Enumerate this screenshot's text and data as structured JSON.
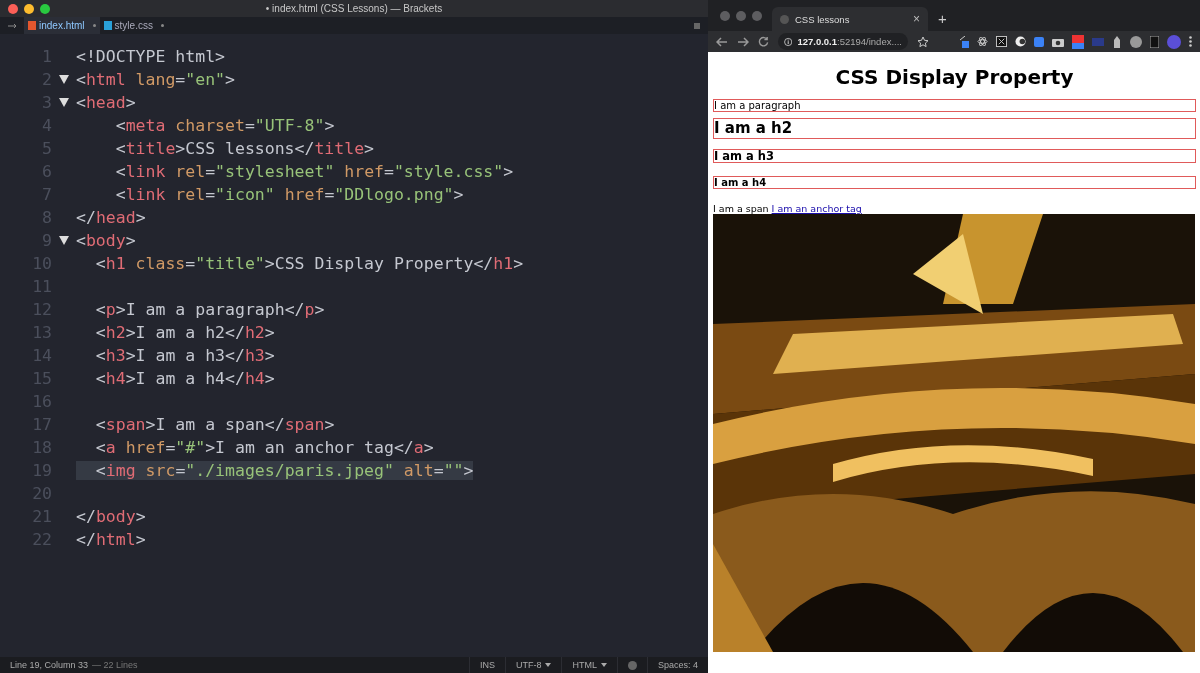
{
  "editor": {
    "window": {
      "title": "• index.html (CSS Lessons) — Brackets"
    },
    "tabs": [
      {
        "label": "index.html",
        "selected": true,
        "kind": "html",
        "modified": true
      },
      {
        "label": "style.css",
        "selected": false,
        "kind": "css",
        "modified": true
      }
    ],
    "lines": [
      {
        "number": "1",
        "fold": false,
        "selected": false,
        "tokens": [
          {
            "kind": "p",
            "text": "<!DOCTYPE html>"
          }
        ]
      },
      {
        "number": "2",
        "fold": true,
        "selected": false,
        "tokens": [
          {
            "kind": "p",
            "text": "<"
          },
          {
            "kind": "t",
            "text": "html"
          },
          {
            "kind": "a",
            "text": " lang"
          },
          {
            "kind": "p",
            "text": "="
          },
          {
            "kind": "s",
            "text": "\"en\""
          },
          {
            "kind": "p",
            "text": ">"
          }
        ]
      },
      {
        "number": "3",
        "fold": true,
        "selected": false,
        "tokens": [
          {
            "kind": "p",
            "text": "<"
          },
          {
            "kind": "t",
            "text": "head"
          },
          {
            "kind": "p",
            "text": ">"
          }
        ]
      },
      {
        "number": "4",
        "fold": false,
        "selected": false,
        "tokens": [
          {
            "kind": "p",
            "text": "    <"
          },
          {
            "kind": "t",
            "text": "meta"
          },
          {
            "kind": "a",
            "text": " charset"
          },
          {
            "kind": "p",
            "text": "="
          },
          {
            "kind": "s",
            "text": "\"UTF-8\""
          },
          {
            "kind": "p",
            "text": ">"
          }
        ]
      },
      {
        "number": "5",
        "fold": false,
        "selected": false,
        "tokens": [
          {
            "kind": "p",
            "text": "    <"
          },
          {
            "kind": "t",
            "text": "title"
          },
          {
            "kind": "p",
            "text": ">CSS lessons</"
          },
          {
            "kind": "t",
            "text": "title"
          },
          {
            "kind": "p",
            "text": ">"
          }
        ]
      },
      {
        "number": "6",
        "fold": false,
        "selected": false,
        "tokens": [
          {
            "kind": "p",
            "text": "    <"
          },
          {
            "kind": "t",
            "text": "link"
          },
          {
            "kind": "a",
            "text": " rel"
          },
          {
            "kind": "p",
            "text": "="
          },
          {
            "kind": "s",
            "text": "\"stylesheet\""
          },
          {
            "kind": "a",
            "text": " href"
          },
          {
            "kind": "p",
            "text": "="
          },
          {
            "kind": "s",
            "text": "\"style.css\""
          },
          {
            "kind": "p",
            "text": ">"
          }
        ]
      },
      {
        "number": "7",
        "fold": false,
        "selected": false,
        "tokens": [
          {
            "kind": "p",
            "text": "    <"
          },
          {
            "kind": "t",
            "text": "link"
          },
          {
            "kind": "a",
            "text": " rel"
          },
          {
            "kind": "p",
            "text": "="
          },
          {
            "kind": "s",
            "text": "\"icon\""
          },
          {
            "kind": "a",
            "text": " href"
          },
          {
            "kind": "p",
            "text": "="
          },
          {
            "kind": "s",
            "text": "\"DDlogo.png\""
          },
          {
            "kind": "p",
            "text": ">"
          }
        ]
      },
      {
        "number": "8",
        "fold": false,
        "selected": false,
        "tokens": [
          {
            "kind": "p",
            "text": "</"
          },
          {
            "kind": "t",
            "text": "head"
          },
          {
            "kind": "p",
            "text": ">"
          }
        ]
      },
      {
        "number": "9",
        "fold": true,
        "selected": false,
        "tokens": [
          {
            "kind": "p",
            "text": "<"
          },
          {
            "kind": "t",
            "text": "body"
          },
          {
            "kind": "p",
            "text": ">"
          }
        ]
      },
      {
        "number": "10",
        "fold": false,
        "selected": false,
        "tokens": [
          {
            "kind": "p",
            "text": "  <"
          },
          {
            "kind": "t",
            "text": "h1"
          },
          {
            "kind": "a",
            "text": " class"
          },
          {
            "kind": "p",
            "text": "="
          },
          {
            "kind": "s",
            "text": "\"title\""
          },
          {
            "kind": "p",
            "text": ">CSS Display Property</"
          },
          {
            "kind": "t",
            "text": "h1"
          },
          {
            "kind": "p",
            "text": ">"
          }
        ]
      },
      {
        "number": "11",
        "fold": false,
        "selected": false
      },
      {
        "number": "12",
        "fold": false,
        "selected": false,
        "tokens": [
          {
            "kind": "p",
            "text": "  <"
          },
          {
            "kind": "t",
            "text": "p"
          },
          {
            "kind": "p",
            "text": ">I am a paragraph</"
          },
          {
            "kind": "t",
            "text": "p"
          },
          {
            "kind": "p",
            "text": ">"
          }
        ]
      },
      {
        "number": "13",
        "fold": false,
        "selected": false,
        "tokens": [
          {
            "kind": "p",
            "text": "  <"
          },
          {
            "kind": "t",
            "text": "h2"
          },
          {
            "kind": "p",
            "text": ">I am a h2</"
          },
          {
            "kind": "t",
            "text": "h2"
          },
          {
            "kind": "p",
            "text": ">"
          }
        ]
      },
      {
        "number": "14",
        "fold": false,
        "selected": false,
        "tokens": [
          {
            "kind": "p",
            "text": "  <"
          },
          {
            "kind": "t",
            "text": "h3"
          },
          {
            "kind": "p",
            "text": ">I am a h3</"
          },
          {
            "kind": "t",
            "text": "h3"
          },
          {
            "kind": "p",
            "text": ">"
          }
        ]
      },
      {
        "number": "15",
        "fold": false,
        "selected": false,
        "tokens": [
          {
            "kind": "p",
            "text": "  <"
          },
          {
            "kind": "t",
            "text": "h4"
          },
          {
            "kind": "p",
            "text": ">I am a h4</"
          },
          {
            "kind": "t",
            "text": "h4"
          },
          {
            "kind": "p",
            "text": ">"
          }
        ]
      },
      {
        "number": "16",
        "fold": false,
        "selected": false
      },
      {
        "number": "17",
        "fold": false,
        "selected": false,
        "tokens": [
          {
            "kind": "p",
            "text": "  <"
          },
          {
            "kind": "t",
            "text": "span"
          },
          {
            "kind": "p",
            "text": ">I am a span</"
          },
          {
            "kind": "t",
            "text": "span"
          },
          {
            "kind": "p",
            "text": ">"
          }
        ]
      },
      {
        "number": "18",
        "fold": false,
        "selected": false,
        "tokens": [
          {
            "kind": "p",
            "text": "  <"
          },
          {
            "kind": "t",
            "text": "a"
          },
          {
            "kind": "a",
            "text": " href"
          },
          {
            "kind": "p",
            "text": "="
          },
          {
            "kind": "s",
            "text": "\"#\""
          },
          {
            "kind": "p",
            "text": ">I am an anchor tag</"
          },
          {
            "kind": "t",
            "text": "a"
          },
          {
            "kind": "p",
            "text": ">"
          }
        ]
      },
      {
        "number": "19",
        "fold": false,
        "selected": true,
        "tokens": [
          {
            "kind": "p",
            "text": "  <"
          },
          {
            "kind": "t",
            "text": "img"
          },
          {
            "kind": "a",
            "text": " src"
          },
          {
            "kind": "p",
            "text": "="
          },
          {
            "kind": "s",
            "text": "\"./images/paris.jpeg\""
          },
          {
            "kind": "a",
            "text": " alt"
          },
          {
            "kind": "p",
            "text": "="
          },
          {
            "kind": "s",
            "text": "\"\""
          },
          {
            "kind": "p",
            "text": ">"
          }
        ]
      },
      {
        "number": "20",
        "fold": false,
        "selected": false
      },
      {
        "number": "21",
        "fold": false,
        "selected": false,
        "tokens": [
          {
            "kind": "p",
            "text": "</"
          },
          {
            "kind": "t",
            "text": "body"
          },
          {
            "kind": "p",
            "text": ">"
          }
        ]
      },
      {
        "number": "22",
        "fold": false,
        "selected": false,
        "tokens": [
          {
            "kind": "p",
            "text": "</"
          },
          {
            "kind": "t",
            "text": "html"
          },
          {
            "kind": "p",
            "text": ">"
          }
        ]
      }
    ],
    "status_bar": {
      "position": "Line 19, Column 33",
      "line_count": "— 22 Lines",
      "mode": "INS",
      "encoding": "UTF-8",
      "language": "HTML",
      "indent": "Spaces: 4"
    }
  },
  "browser": {
    "tab": {
      "title": "CSS lessons",
      "close": "×"
    },
    "new_tab": "+",
    "address": {
      "host": "127.0.0.1",
      "rest": ":52194/index...."
    },
    "page": {
      "title": "CSS Display Property",
      "blocks": [
        {
          "kind": "p",
          "text": "I am a paragraph"
        },
        {
          "kind": "h2",
          "text": "I am a h2"
        },
        {
          "kind": "h3",
          "text": "I am a h3"
        },
        {
          "kind": "h4",
          "text": "I am a h4"
        }
      ],
      "span": "I am a span",
      "link": "I am an anchor tag"
    }
  }
}
